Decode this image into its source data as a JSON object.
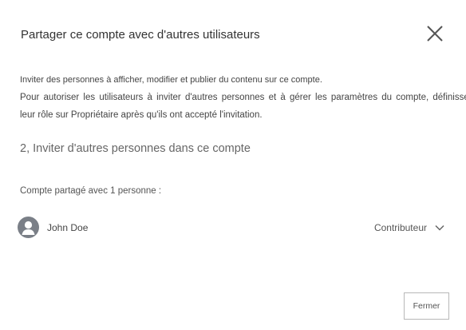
{
  "dialog": {
    "title": "Partager ce compte avec d'autres utilisateurs",
    "close_icon": "close-icon"
  },
  "description": {
    "line1": "Inviter des personnes à afficher, modifier et publier du contenu sur ce compte.",
    "line2": "Pour autoriser les utilisateurs à inviter d'autres personnes et à gérer les paramètres du compte, définissez",
    "line3": "leur rôle sur Propriétaire après qu'ils ont accepté l'invitation."
  },
  "invite_section": {
    "heading": "2, Inviter d'autres personnes dans ce compte"
  },
  "shared": {
    "label": "Compte partagé avec 1 personne :",
    "users": [
      {
        "name": "John Doe",
        "role": "Contributeur",
        "avatar_icon": "user-avatar-icon"
      }
    ]
  },
  "footer": {
    "close_label": "Fermer"
  },
  "colors": {
    "avatar_bg": "#7a7f87",
    "text": "#333333",
    "muted_text": "#666666",
    "border": "#b8b8b8"
  }
}
